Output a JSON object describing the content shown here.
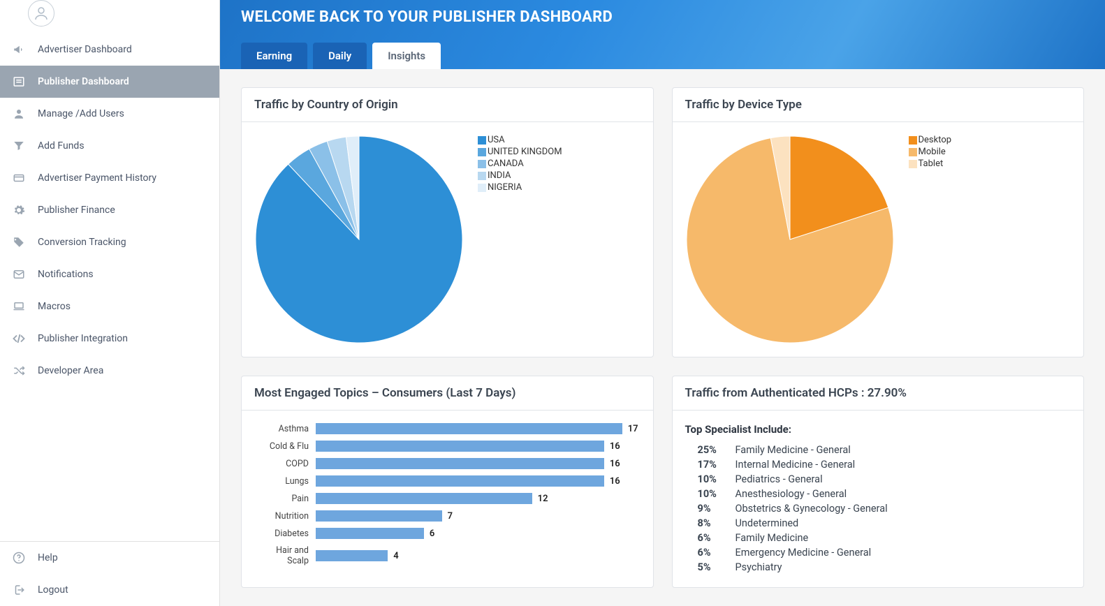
{
  "hero": {
    "title": "WELCOME BACK TO YOUR PUBLISHER DASHBOARD"
  },
  "tabs": [
    {
      "label": "Earning",
      "active": false
    },
    {
      "label": "Daily",
      "active": false
    },
    {
      "label": "Insights",
      "active": true
    }
  ],
  "sidebar": {
    "items": [
      {
        "label": "Advertiser Dashboard",
        "icon": "bullhorn"
      },
      {
        "label": "Publisher Dashboard",
        "icon": "newspaper",
        "active": true
      },
      {
        "label": "Manage /Add Users",
        "icon": "user"
      },
      {
        "label": "Add Funds",
        "icon": "funnel-dollar"
      },
      {
        "label": "Advertiser Payment History",
        "icon": "card"
      },
      {
        "label": "Publisher Finance",
        "icon": "gear"
      },
      {
        "label": "Conversion Tracking",
        "icon": "tag"
      },
      {
        "label": "Notifications",
        "icon": "envelope"
      },
      {
        "label": "Macros",
        "icon": "laptop"
      },
      {
        "label": "Publisher Integration",
        "icon": "code"
      },
      {
        "label": "Developer Area",
        "icon": "shuffle"
      }
    ],
    "footer": [
      {
        "label": "Help",
        "icon": "help"
      },
      {
        "label": "Logout",
        "icon": "logout"
      }
    ]
  },
  "cards": {
    "country": {
      "title": "Traffic by Country of Origin"
    },
    "device": {
      "title": "Traffic by Device Type"
    },
    "topics": {
      "title": "Most Engaged Topics – Consumers (Last 7 Days)"
    },
    "hcp": {
      "title": "Traffic from Authenticated HCPs : 27.90%",
      "subTitle": "Top Specialist Include:"
    }
  },
  "chart_data": [
    {
      "id": "country_pie",
      "type": "pie",
      "title": "Traffic by Country of Origin",
      "series": [
        {
          "name": "USA",
          "value": 88,
          "color": "#2d8fd6"
        },
        {
          "name": "UNITED KINGDOM",
          "value": 4,
          "color": "#5aa7de"
        },
        {
          "name": "CANADA",
          "value": 3,
          "color": "#8bc0e8"
        },
        {
          "name": "INDIA",
          "value": 3,
          "color": "#b8d8f0"
        },
        {
          "name": "NIGERIA",
          "value": 2,
          "color": "#e0eef9"
        }
      ]
    },
    {
      "id": "device_pie",
      "type": "pie",
      "title": "Traffic by Device Type",
      "series": [
        {
          "name": "Desktop",
          "value": 20,
          "color": "#f28f1c"
        },
        {
          "name": "Mobile",
          "value": 77,
          "color": "#f6b96a"
        },
        {
          "name": "Tablet",
          "value": 3,
          "color": "#fce2c0"
        }
      ]
    },
    {
      "id": "topics_bar",
      "type": "bar",
      "title": "Most Engaged Topics – Consumers (Last 7 Days)",
      "orientation": "horizontal",
      "xlabel": "",
      "ylabel": "",
      "xlim": [
        0,
        18
      ],
      "categories": [
        "Asthma",
        "Cold & Flu",
        "COPD",
        "Lungs",
        "Pain",
        "Nutrition",
        "Diabetes",
        "Hair and Scalp"
      ],
      "values": [
        17,
        16,
        16,
        16,
        12,
        7,
        6,
        4
      ],
      "bar_color": "#6ea6de"
    }
  ],
  "hcp_specialists": [
    {
      "pct": "25%",
      "name": "Family Medicine - General"
    },
    {
      "pct": "17%",
      "name": "Internal Medicine - General"
    },
    {
      "pct": "10%",
      "name": "Pediatrics - General"
    },
    {
      "pct": "10%",
      "name": "Anesthesiology - General"
    },
    {
      "pct": "9%",
      "name": "Obstetrics & Gynecology - General"
    },
    {
      "pct": "8%",
      "name": "Undetermined"
    },
    {
      "pct": "6%",
      "name": "Family Medicine"
    },
    {
      "pct": "6%",
      "name": "Emergency Medicine - General"
    },
    {
      "pct": "5%",
      "name": "Psychiatry"
    }
  ]
}
